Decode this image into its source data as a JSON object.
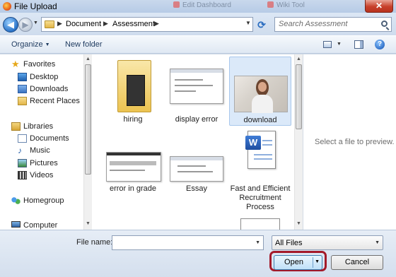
{
  "window": {
    "title": "File Upload",
    "close_glyph": "✕",
    "background_tabs": [
      "Edit Dashboard",
      "Wiki Tool"
    ]
  },
  "address_bar": {
    "back_glyph": "◀",
    "forward_glyph": "▶",
    "breadcrumbs": [
      "Document",
      "Assessment"
    ],
    "separator": "▶",
    "refresh_glyph": "⟳"
  },
  "search": {
    "placeholder": "Search Assessment"
  },
  "toolbar": {
    "organize_label": "Organize",
    "new_folder_label": "New folder",
    "help_glyph": "?"
  },
  "sidebar": {
    "favorites": {
      "label": "Favorites",
      "items": [
        "Desktop",
        "Downloads",
        "Recent Places"
      ]
    },
    "libraries": {
      "label": "Libraries",
      "items": [
        "Documents",
        "Music",
        "Pictures",
        "Videos"
      ]
    },
    "homegroup": {
      "label": "Homegroup"
    },
    "computer": {
      "label": "Computer"
    }
  },
  "files": [
    {
      "name": "hiring",
      "type": "folder"
    },
    {
      "name": "display error",
      "type": "image"
    },
    {
      "name": "download",
      "type": "photo",
      "selected": true
    },
    {
      "name": "error in grade",
      "type": "image"
    },
    {
      "name": "Essay",
      "type": "image"
    },
    {
      "name": "Fast and Efficient Recruitment Process",
      "type": "word-document",
      "lines": [
        "Fast and Efficient",
        "Recruitment",
        "Process"
      ]
    }
  ],
  "preview": {
    "message": "Select a file to preview."
  },
  "footer": {
    "file_name_label": "File name:",
    "file_name_value": "",
    "file_type_filter": "All Files",
    "open_label": "Open",
    "cancel_label": "Cancel",
    "highlight_color": "#a31a2a"
  }
}
